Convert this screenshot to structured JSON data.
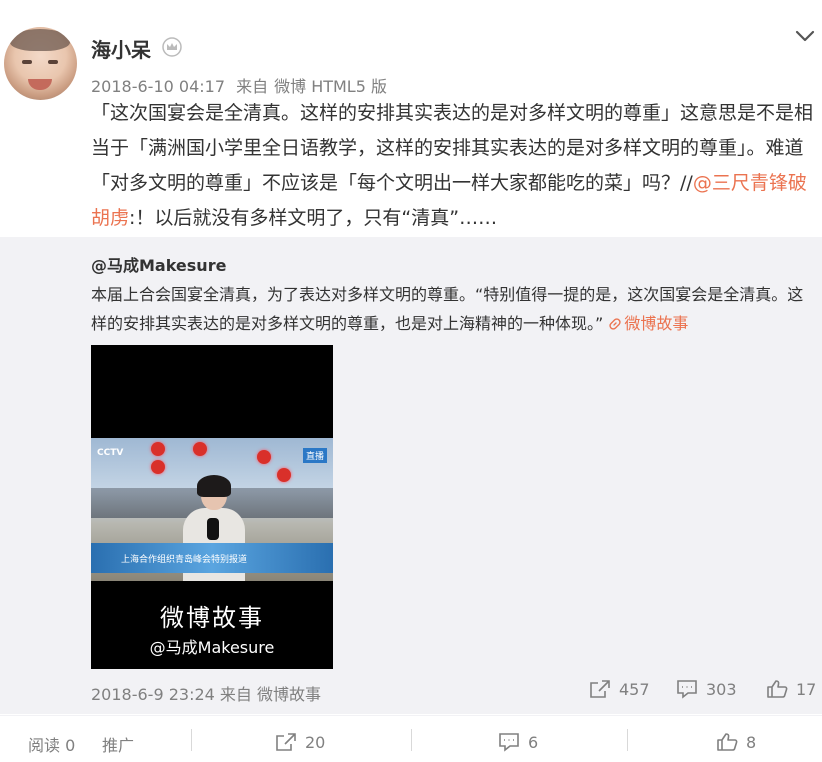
{
  "post": {
    "username": "海小呆",
    "time": "2018-6-10 04:17",
    "source_prefix": "来自",
    "source": "微博 HTML5 版",
    "text_before": "「这次国宴会是全清真。这样的安排其实表达的是对多样文明的尊重」这意思是不是相当于「满洲国小学里全日语教学，这样的安排其实表达的是对多样文明的尊重」。难道「对多文明的尊重」不应该是「每个文明出一样大家都能吃的菜」吗？//",
    "mention": "@三尺青锋破胡虏",
    "text_after": ":！以后就没有多样文明了，只有“清真”……"
  },
  "repost": {
    "author": "@马成Makesure",
    "text": "本届上合会国宴全清真，为了表达对多样文明的尊重。“特别值得一提的是，这次国宴会是全清真。这样的安排其实表达的是对多样文明的尊重，也是对上海精神的一种体现。”",
    "link_label": "微博故事",
    "video": {
      "channel": "CCTV",
      "live_badge": "直播",
      "banner": "上海合作组织青岛峰会特别报道",
      "story_title": "微博故事",
      "story_author": "@马成Makesure"
    },
    "time": "2018-6-9 23:24",
    "source_prefix": "来自",
    "source": "微博故事",
    "reposts": "457",
    "comments": "303",
    "likes": "17"
  },
  "footer": {
    "reads_label": "阅读 0",
    "promote_label": "推广",
    "reposts": "20",
    "comments": "6",
    "likes": "8"
  },
  "colors": {
    "accent": "#eb7350",
    "meta": "#808080",
    "repost_bg": "#f2f2f5"
  },
  "icons": [
    "crown-icon",
    "chevron-down-icon",
    "link-icon",
    "repost-icon",
    "comment-icon",
    "like-icon"
  ]
}
